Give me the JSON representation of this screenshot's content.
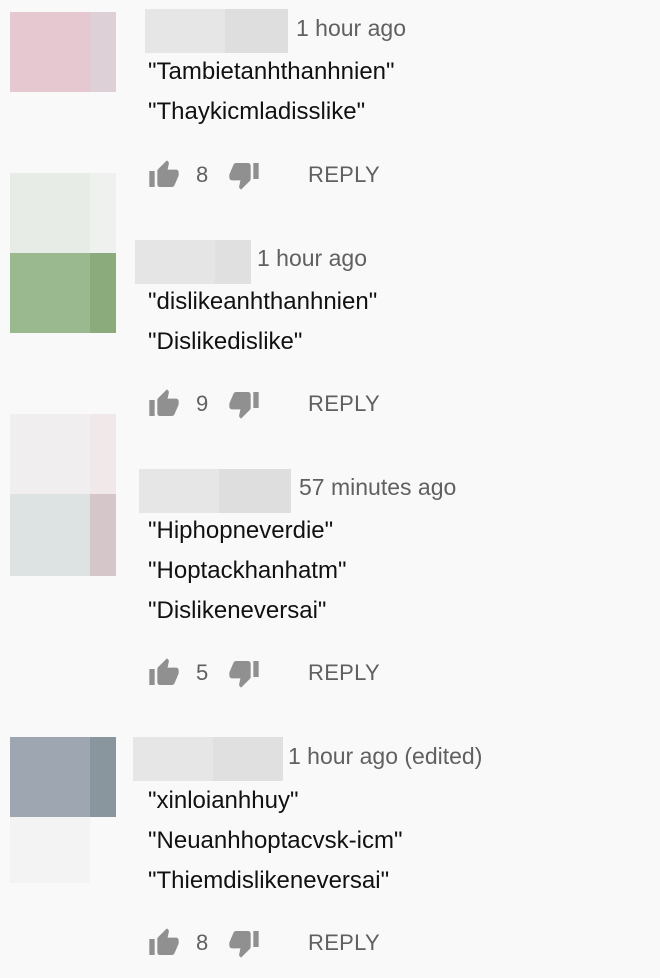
{
  "comments": [
    {
      "time": "1 hour ago",
      "lines": [
        "\"Tambietanhthanhnien\"",
        "\"Thaykicmladisslike\""
      ],
      "likes": "8",
      "reply": "REPLY"
    },
    {
      "time": "1 hour ago",
      "lines": [
        "\"dislikeanhthanhnien\"",
        "\"Dislikedislike\""
      ],
      "likes": "9",
      "reply": "REPLY"
    },
    {
      "time": "57 minutes ago",
      "lines": [
        "\"Hiphopneverdie\"",
        "\"Hoptackhanhatm\"",
        "\"Dislikeneversai\""
      ],
      "likes": "5",
      "reply": "REPLY"
    },
    {
      "time": "1 hour ago (edited)",
      "lines": [
        "\"xinloianhhuy\"",
        "\"Neuanhhoptacvsk-icm\"",
        "\"Thiemdislikeneversai\""
      ],
      "likes": "8",
      "reply": "REPLY"
    }
  ],
  "icons": {
    "like": "thumbs-up-icon",
    "dislike": "thumbs-down-icon"
  },
  "colors": {
    "background": "#f9f9f9",
    "secondary_text": "#606060",
    "icon": "#909090"
  }
}
